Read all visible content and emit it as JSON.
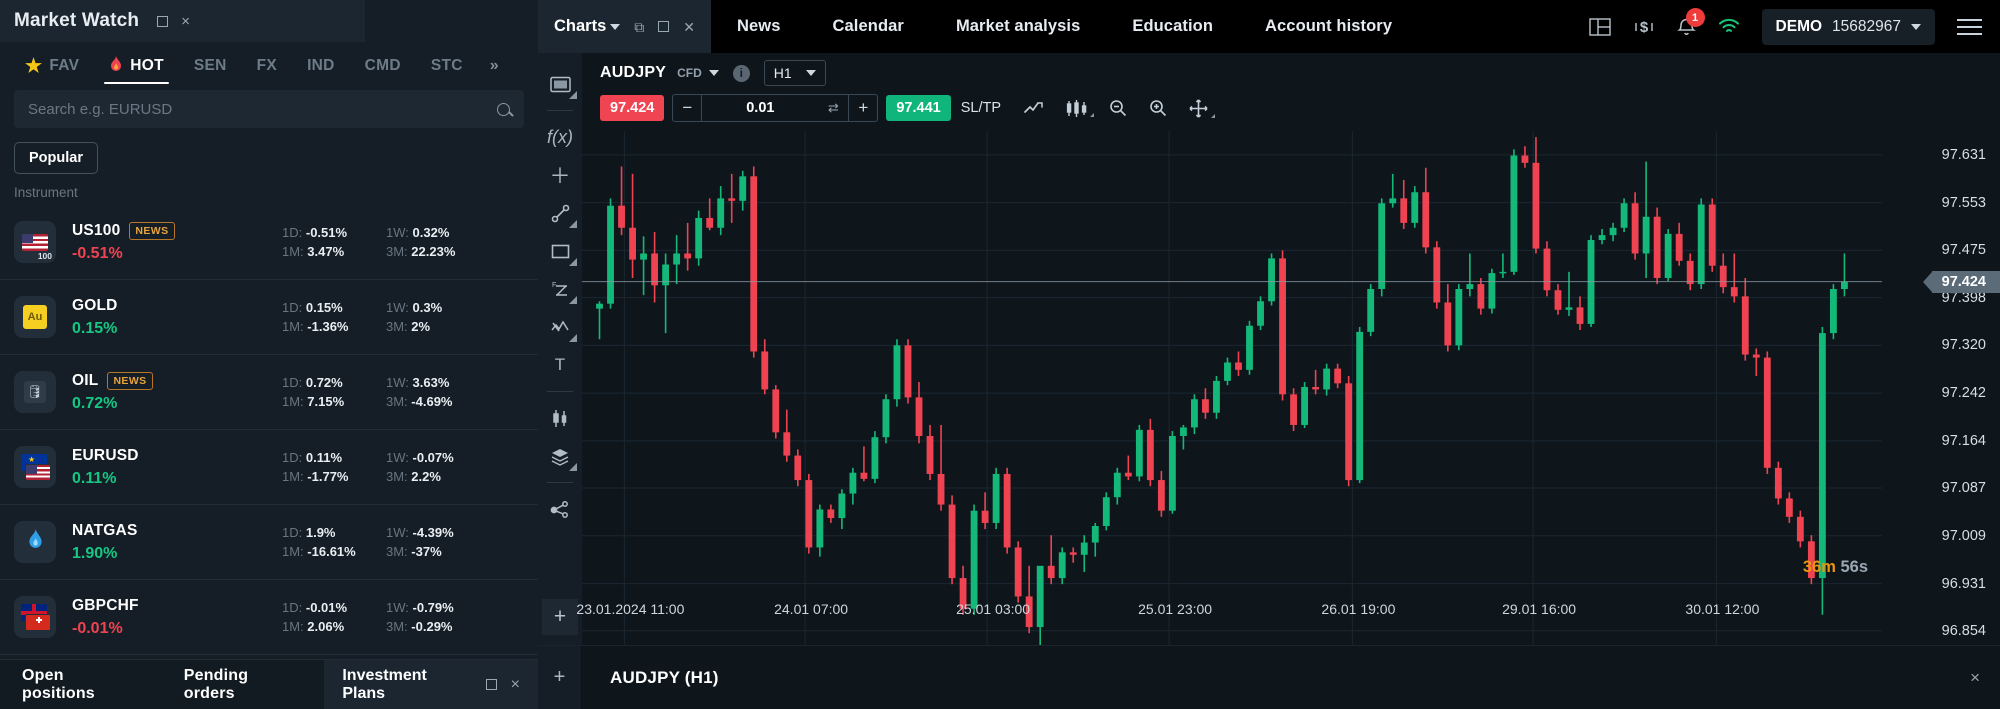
{
  "market_watch": {
    "title": "Market Watch",
    "window_buttons": {
      "maximize": "□",
      "close": "×"
    },
    "tabs": [
      {
        "label": "FAV",
        "icon": "star-icon",
        "active": false
      },
      {
        "label": "HOT",
        "icon": "flame-icon",
        "active": true
      },
      {
        "label": "SEN",
        "active": false
      },
      {
        "label": "FX",
        "active": false
      },
      {
        "label": "IND",
        "active": false
      },
      {
        "label": "CMD",
        "active": false
      },
      {
        "label": "STC",
        "active": false
      }
    ],
    "tabs_overflow": "»",
    "search": {
      "placeholder": "Search e.g. EURUSD",
      "value": ""
    },
    "filter_chip": "Popular",
    "column_header": "Instrument",
    "instruments": [
      {
        "symbol": "US100",
        "badge": "NEWS",
        "change": "-0.51%",
        "direction": "neg",
        "icon": "us-flag-100-icon",
        "stats": [
          {
            "k": "1D:",
            "v": "-0.51%"
          },
          {
            "k": "1W:",
            "v": "0.32%"
          },
          {
            "k": "1M:",
            "v": "3.47%"
          },
          {
            "k": "3M:",
            "v": "22.23%"
          }
        ]
      },
      {
        "symbol": "GOLD",
        "badge": "",
        "change": "0.15%",
        "direction": "pos",
        "icon": "gold-icon",
        "stats": [
          {
            "k": "1D:",
            "v": "0.15%"
          },
          {
            "k": "1W:",
            "v": "0.3%"
          },
          {
            "k": "1M:",
            "v": "-1.36%"
          },
          {
            "k": "3M:",
            "v": "2%"
          }
        ]
      },
      {
        "symbol": "OIL",
        "badge": "NEWS",
        "change": "0.72%",
        "direction": "pos",
        "icon": "oil-barrel-icon",
        "stats": [
          {
            "k": "1D:",
            "v": "0.72%"
          },
          {
            "k": "1W:",
            "v": "3.63%"
          },
          {
            "k": "1M:",
            "v": "7.15%"
          },
          {
            "k": "3M:",
            "v": "-4.69%"
          }
        ]
      },
      {
        "symbol": "EURUSD",
        "badge": "",
        "change": "0.11%",
        "direction": "pos",
        "icon": "eu-us-flag-icon",
        "stats": [
          {
            "k": "1D:",
            "v": "0.11%"
          },
          {
            "k": "1W:",
            "v": "-0.07%"
          },
          {
            "k": "1M:",
            "v": "-1.77%"
          },
          {
            "k": "3M:",
            "v": "2.2%"
          }
        ]
      },
      {
        "symbol": "NATGAS",
        "badge": "",
        "change": "1.90%",
        "direction": "pos",
        "icon": "natural-gas-flame-icon",
        "stats": [
          {
            "k": "1D:",
            "v": "1.9%"
          },
          {
            "k": "1W:",
            "v": "-4.39%"
          },
          {
            "k": "1M:",
            "v": "-16.61%"
          },
          {
            "k": "3M:",
            "v": "-37%"
          }
        ]
      },
      {
        "symbol": "GBPCHF",
        "badge": "",
        "change": "-0.01%",
        "direction": "neg",
        "icon": "gb-ch-flag-icon",
        "stats": [
          {
            "k": "1D:",
            "v": "-0.01%"
          },
          {
            "k": "1W:",
            "v": "-0.79%"
          },
          {
            "k": "1M:",
            "v": "2.06%"
          },
          {
            "k": "3M:",
            "v": "-0.29%"
          }
        ]
      }
    ],
    "bottom_tabs": [
      {
        "label": "Open positions",
        "selected": false
      },
      {
        "label": "Pending orders",
        "selected": false
      },
      {
        "label": "Investment Plans",
        "selected": true
      }
    ]
  },
  "topbar": {
    "charts_tab": "Charts",
    "nav": [
      {
        "label": "News"
      },
      {
        "label": "Calendar"
      },
      {
        "label": "Market analysis"
      },
      {
        "label": "Education"
      },
      {
        "label": "Account history"
      }
    ],
    "icons": [
      "layout-icon",
      "dollar-icon",
      "bell-icon",
      "wifi-icon"
    ],
    "notification_count": "1",
    "account": {
      "type": "DEMO",
      "number": "15682967"
    }
  },
  "chart_toolbar": {
    "symbol": "AUDJPY",
    "symbol_kind": "CFD",
    "timeframe": "H1",
    "bid": "97.424",
    "ask": "97.441",
    "volume": "0.01",
    "minus": "−",
    "plus": "+",
    "sltp": "SL/TP",
    "icons": [
      "line-chart-icon",
      "candlestick-icon",
      "zoom-out-icon",
      "zoom-in-icon",
      "crosshair-move-icon"
    ]
  },
  "left_tools": [
    "chart-type-icon",
    "indicators-fx-icon",
    "crosshair-icon",
    "trendline-icon",
    "rectangle-icon",
    "fibonacci-icon",
    "elliott-wave-icon",
    "text-tool-icon",
    "vertical-compare-icon",
    "layers-icon",
    "share-icon",
    "add-chart-icon"
  ],
  "bottom_strip": {
    "add": "+",
    "title": "AUDJPY (H1)",
    "close": "×"
  },
  "countdown": {
    "minutes": "36m",
    "seconds": "56s"
  },
  "chart_data": {
    "type": "candlestick",
    "title": "AUDJPY (H1)",
    "symbol": "AUDJPY",
    "timeframe": "H1",
    "current_price": "97.424",
    "bid": "97.424",
    "ask": "97.441",
    "y_ticks": [
      "97.631",
      "97.553",
      "97.475",
      "97.398",
      "97.320",
      "97.242",
      "97.164",
      "97.087",
      "97.009",
      "96.931",
      "96.854"
    ],
    "ylim": [
      96.816,
      97.67
    ],
    "x_ticks": [
      "23.01.2024 11:00",
      "24.01 07:00",
      "25.01 03:00",
      "25.01 23:00",
      "26.01 19:00",
      "29.01 16:00",
      "30.01 12:00"
    ],
    "x_tick_positions": [
      0.028,
      0.167,
      0.307,
      0.447,
      0.588,
      0.727,
      0.868
    ],
    "grid": true,
    "colors": {
      "up": "#14b97a",
      "down": "#ef4352",
      "grid": "#1b2730",
      "bg": "#0e161c"
    },
    "candles": [
      [
        97.38,
        97.392,
        97.33,
        97.388
      ],
      [
        97.388,
        97.56,
        97.38,
        97.548
      ],
      [
        97.548,
        97.612,
        97.5,
        97.512
      ],
      [
        97.512,
        97.6,
        97.43,
        97.46
      ],
      [
        97.46,
        97.498,
        97.402,
        97.47
      ],
      [
        97.47,
        97.505,
        97.39,
        97.418
      ],
      [
        97.418,
        97.47,
        97.34,
        97.452
      ],
      [
        97.452,
        97.5,
        97.42,
        97.47
      ],
      [
        97.47,
        97.52,
        97.442,
        97.462
      ],
      [
        97.462,
        97.54,
        97.45,
        97.528
      ],
      [
        97.528,
        97.56,
        97.508,
        97.512
      ],
      [
        97.512,
        97.58,
        97.5,
        97.56
      ],
      [
        97.56,
        97.6,
        97.52,
        97.556
      ],
      [
        97.556,
        97.605,
        97.54,
        97.596
      ],
      [
        97.596,
        97.612,
        97.3,
        97.31
      ],
      [
        97.31,
        97.33,
        97.24,
        97.248
      ],
      [
        97.248,
        97.255,
        97.168,
        97.178
      ],
      [
        97.178,
        97.215,
        97.13,
        97.14
      ],
      [
        97.14,
        97.15,
        97.09,
        97.1
      ],
      [
        97.1,
        97.11,
        96.98,
        96.99
      ],
      [
        96.99,
        97.06,
        96.975,
        97.052
      ],
      [
        97.052,
        97.06,
        97.03,
        97.038
      ],
      [
        97.038,
        97.085,
        97.02,
        97.078
      ],
      [
        97.078,
        97.12,
        97.06,
        97.112
      ],
      [
        97.112,
        97.155,
        97.098,
        97.102
      ],
      [
        97.102,
        97.18,
        97.095,
        97.17
      ],
      [
        97.17,
        97.24,
        97.16,
        97.232
      ],
      [
        97.232,
        97.33,
        97.22,
        97.32
      ],
      [
        97.32,
        97.33,
        97.225,
        97.235
      ],
      [
        97.235,
        97.26,
        97.16,
        97.172
      ],
      [
        97.172,
        97.19,
        97.1,
        97.11
      ],
      [
        97.11,
        97.19,
        97.05,
        97.06
      ],
      [
        97.06,
        97.075,
        96.93,
        96.94
      ],
      [
        96.94,
        96.96,
        96.88,
        96.89
      ],
      [
        96.89,
        97.06,
        96.88,
        97.05
      ],
      [
        97.05,
        97.08,
        97.02,
        97.03
      ],
      [
        97.03,
        97.12,
        97.02,
        97.11
      ],
      [
        97.11,
        97.12,
        96.98,
        96.99
      ],
      [
        96.99,
        97.0,
        96.9,
        96.91
      ],
      [
        96.91,
        96.96,
        96.85,
        96.86
      ],
      [
        96.86,
        96.87,
        96.81,
        96.96
      ],
      [
        96.96,
        97.01,
        96.93,
        96.94
      ],
      [
        96.94,
        96.99,
        96.93,
        96.982
      ],
      [
        96.982,
        96.99,
        96.965,
        96.978
      ],
      [
        96.978,
        97.01,
        96.95,
        96.998
      ],
      [
        96.998,
        97.03,
        96.975,
        97.025
      ],
      [
        97.025,
        97.08,
        97.018,
        97.072
      ],
      [
        97.072,
        97.12,
        97.06,
        97.112
      ],
      [
        97.112,
        97.14,
        97.1,
        97.106
      ],
      [
        97.106,
        97.19,
        97.098,
        97.182
      ],
      [
        97.182,
        97.2,
        97.09,
        97.1
      ],
      [
        97.1,
        97.115,
        97.04,
        97.05
      ],
      [
        97.05,
        97.18,
        97.045,
        97.172
      ],
      [
        97.172,
        97.19,
        97.15,
        97.186
      ],
      [
        97.186,
        97.24,
        97.175,
        97.232
      ],
      [
        97.232,
        97.25,
        97.2,
        97.21
      ],
      [
        97.21,
        97.27,
        97.2,
        97.262
      ],
      [
        97.262,
        97.3,
        97.255,
        97.292
      ],
      [
        97.292,
        97.31,
        97.27,
        97.28
      ],
      [
        97.28,
        97.36,
        97.272,
        97.352
      ],
      [
        97.352,
        97.4,
        97.345,
        97.392
      ],
      [
        97.392,
        97.47,
        97.385,
        97.462
      ],
      [
        97.462,
        97.475,
        97.23,
        97.24
      ],
      [
        97.24,
        97.25,
        97.18,
        97.19
      ],
      [
        97.19,
        97.26,
        97.185,
        97.252
      ],
      [
        97.252,
        97.28,
        97.24,
        97.248
      ],
      [
        97.248,
        97.29,
        97.238,
        97.282
      ],
      [
        97.282,
        97.29,
        97.25,
        97.258
      ],
      [
        97.258,
        97.27,
        97.09,
        97.1
      ],
      [
        97.1,
        97.35,
        97.095,
        97.342
      ],
      [
        97.342,
        97.42,
        97.335,
        97.412
      ],
      [
        97.412,
        97.56,
        97.4,
        97.552
      ],
      [
        97.552,
        97.6,
        97.545,
        97.56
      ],
      [
        97.56,
        97.59,
        97.51,
        97.52
      ],
      [
        97.52,
        97.58,
        97.512,
        97.57
      ],
      [
        97.57,
        97.61,
        97.47,
        97.48
      ],
      [
        97.48,
        97.49,
        97.38,
        97.39
      ],
      [
        97.39,
        97.42,
        97.31,
        97.32
      ],
      [
        97.32,
        97.42,
        97.312,
        97.412
      ],
      [
        97.412,
        97.47,
        97.4,
        97.42
      ],
      [
        97.42,
        97.43,
        97.37,
        97.38
      ],
      [
        97.38,
        97.445,
        97.372,
        97.438
      ],
      [
        97.438,
        97.47,
        97.43,
        97.44
      ],
      [
        97.44,
        97.64,
        97.435,
        97.63
      ],
      [
        97.63,
        97.645,
        97.61,
        97.618
      ],
      [
        97.618,
        97.66,
        97.47,
        97.478
      ],
      [
        97.478,
        97.49,
        97.4,
        97.41
      ],
      [
        97.41,
        97.42,
        97.37,
        97.378
      ],
      [
        97.378,
        97.44,
        97.368,
        97.382
      ],
      [
        97.382,
        97.4,
        97.345,
        97.355
      ],
      [
        97.355,
        97.5,
        97.35,
        97.492
      ],
      [
        97.492,
        97.51,
        97.485,
        97.5
      ],
      [
        97.5,
        97.52,
        97.49,
        97.512
      ],
      [
        97.512,
        97.56,
        97.505,
        97.552
      ],
      [
        97.552,
        97.57,
        97.46,
        97.47
      ],
      [
        97.47,
        97.62,
        97.43,
        97.53
      ],
      [
        97.53,
        97.545,
        97.42,
        97.43
      ],
      [
        97.43,
        97.51,
        97.425,
        97.502
      ],
      [
        97.502,
        97.52,
        97.45,
        97.458
      ],
      [
        97.458,
        97.47,
        97.41,
        97.42
      ],
      [
        97.42,
        97.56,
        97.412,
        97.55
      ],
      [
        97.55,
        97.56,
        97.44,
        97.45
      ],
      [
        97.45,
        97.47,
        97.405,
        97.415
      ],
      [
        97.415,
        97.47,
        97.39,
        97.4
      ],
      [
        97.4,
        97.43,
        97.295,
        97.305
      ],
      [
        97.305,
        97.315,
        97.27,
        97.3
      ],
      [
        97.3,
        97.31,
        97.11,
        97.12
      ],
      [
        97.12,
        97.13,
        97.06,
        97.07
      ],
      [
        97.07,
        97.08,
        97.03,
        97.04
      ],
      [
        97.04,
        97.05,
        96.99,
        97.0
      ],
      [
        97.0,
        97.01,
        96.93,
        96.94
      ],
      [
        96.94,
        97.35,
        96.88,
        97.34
      ],
      [
        97.34,
        97.42,
        97.33,
        97.412
      ],
      [
        97.412,
        97.47,
        97.4,
        97.424
      ]
    ]
  }
}
